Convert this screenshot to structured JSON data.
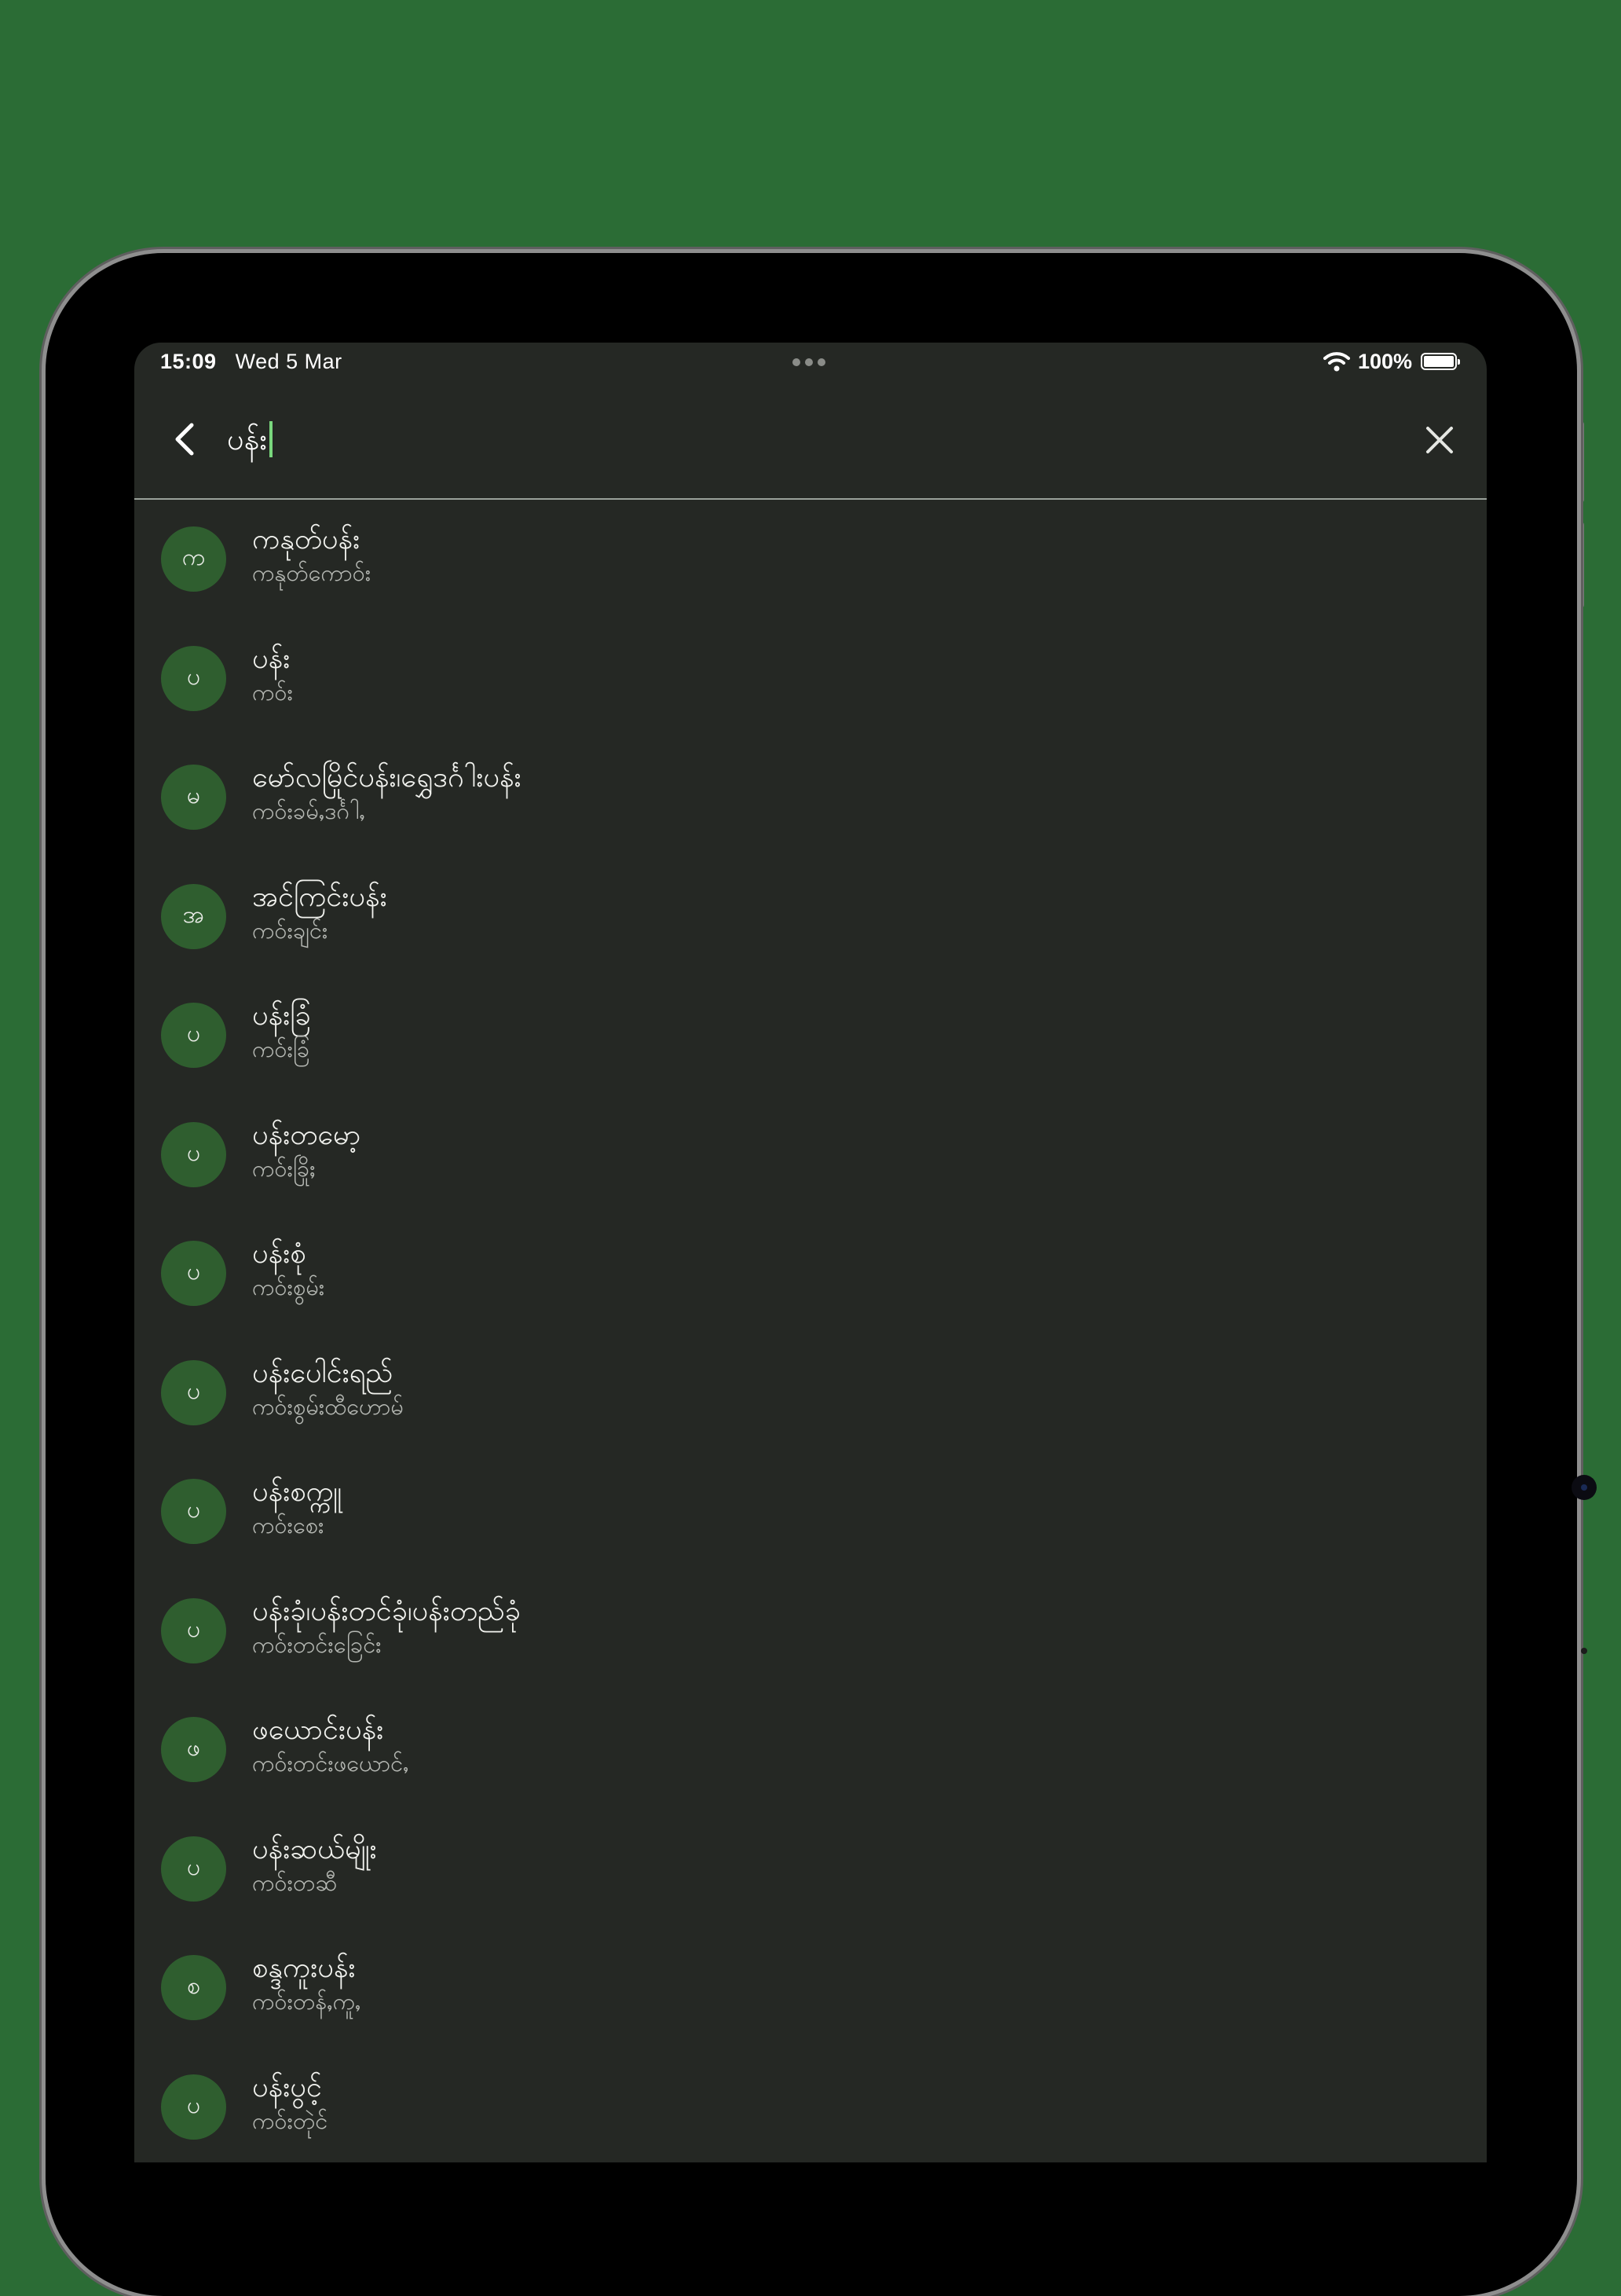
{
  "status_bar": {
    "time": "15:09",
    "date": "Wed 5 Mar",
    "battery_percent": "100%",
    "wifi_icon": "wifi-icon",
    "battery_icon": "battery-full-icon"
  },
  "search": {
    "query": "ပန်း",
    "back_icon": "chevron-left-icon",
    "clear_icon": "close-icon"
  },
  "results": [
    {
      "initial": "က",
      "title": "ကနုတ်ပန်း",
      "subtitle": "ကနုတ်ကောဝ်း"
    },
    {
      "initial": "ပ",
      "title": "ပန်း",
      "subtitle": "ကဝ်း"
    },
    {
      "initial": "မ",
      "title": "မော်လမြိုင်ပန်း၊ရွှေဒင်္ဂါးပန်း",
      "subtitle": "ကဝ်းခမ်ႇဒင်္ဂါႇ"
    },
    {
      "initial": "အ",
      "title": "အင်ကြင်းပန်း",
      "subtitle": "ကဝ်းချင်း"
    },
    {
      "initial": "ပ",
      "title": "ပန်းခြံ",
      "subtitle": "ကဝ်းခြံ"
    },
    {
      "initial": "ပ",
      "title": "ပန်းတမော့",
      "subtitle": "ကဝ်းခြိုႈ"
    },
    {
      "initial": "ပ",
      "title": "ပန်းစုံ",
      "subtitle": "ကဝ်းစွမ်း"
    },
    {
      "initial": "ပ",
      "title": "ပန်းပေါင်းရည်",
      "subtitle": "ကဝ်းစွမ်းထီဟောမ်"
    },
    {
      "initial": "ပ",
      "title": "ပန်းစက္ကူ",
      "subtitle": "ကဝ်းစေး"
    },
    {
      "initial": "ပ",
      "title": "ပန်းခုံ၊ပန်းတင်ခုံ၊ပန်းတည်ခုံ",
      "subtitle": "ကဝ်းတင်းခြေင်း"
    },
    {
      "initial": "ဖ",
      "title": "ဖယောင်းပန်း",
      "subtitle": "ကဝ်းတင်းဖယောင်ႇ"
    },
    {
      "initial": "ပ",
      "title": "ပန်းဆယ်မျိုး",
      "subtitle": "ကဝ်းတဆီ"
    },
    {
      "initial": "စ",
      "title": "စန္ဒကူးပန်း",
      "subtitle": "ကဝ်းတန်ႇကူႇ"
    },
    {
      "initial": "ပ",
      "title": "ပန်းပွင့်",
      "subtitle": "ကဝ်းတုဲင်"
    }
  ],
  "colors": {
    "page_background": "#2b6c35",
    "screen_background": "#252824",
    "avatar_background": "#2f5e2f",
    "caret": "#79d77d"
  }
}
